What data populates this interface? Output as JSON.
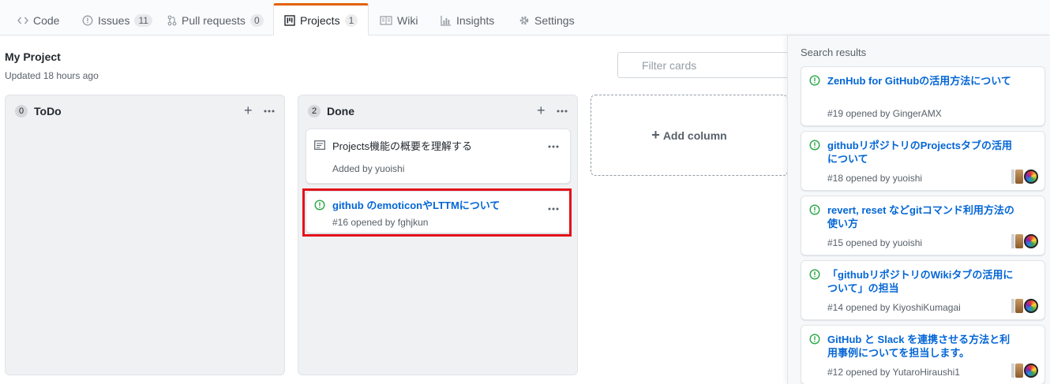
{
  "tabs": [
    {
      "label": "Code",
      "icon": "code-icon"
    },
    {
      "label": "Issues",
      "count": "11",
      "icon": "issue-opened-icon"
    },
    {
      "label": "Pull requests",
      "count": "0",
      "icon": "pull-request-icon"
    },
    {
      "label": "Projects",
      "count": "1",
      "icon": "project-icon",
      "selected": true
    },
    {
      "label": "Wiki",
      "icon": "book-icon"
    },
    {
      "label": "Insights",
      "icon": "graph-icon"
    },
    {
      "label": "Settings",
      "icon": "gear-icon"
    }
  ],
  "project": {
    "title": "My Project",
    "updated": "Updated 18 hours ago",
    "filter_placeholder": "Filter cards"
  },
  "columns": [
    {
      "name": "ToDo",
      "count": "0",
      "cards": []
    },
    {
      "name": "Done",
      "count": "2",
      "cards": [
        {
          "type": "note",
          "text": "Projects機能の概要を理解する",
          "added": "Added by yuoishi"
        },
        {
          "type": "issue",
          "title": "github のemoticonやLTTMについて",
          "meta": "#16 opened by fghjkun",
          "highlighted": true
        }
      ]
    }
  ],
  "add_column_label": "Add column",
  "sidebar": {
    "title": "Search results",
    "results": [
      {
        "title": "ZenHub for GitHubの活用方法について",
        "meta": "#19 opened by GingerAMX",
        "avatars": false
      },
      {
        "title": "githubリポジトリのProjectsタブの活用について",
        "meta": "#18 opened by yuoishi",
        "avatars": true
      },
      {
        "title": "revert, reset などgitコマンド利用方法の使い方",
        "meta": "#15 opened by yuoishi",
        "avatars": true
      },
      {
        "title": "「githubリポジトリのWikiタブの活用について」の担当",
        "meta": "#14 opened by KiyoshiKumagai",
        "avatars": true
      },
      {
        "title": "GitHub と Slack を連携させる方法と利用事例についてを担当します。",
        "meta": "#12 opened by YutaroHiraushi1",
        "avatars": true
      }
    ]
  },
  "colors": {
    "accent_tab": "#e36209",
    "link": "#0366d6",
    "open_issue": "#28a745",
    "highlight_box": "#e3121a"
  }
}
